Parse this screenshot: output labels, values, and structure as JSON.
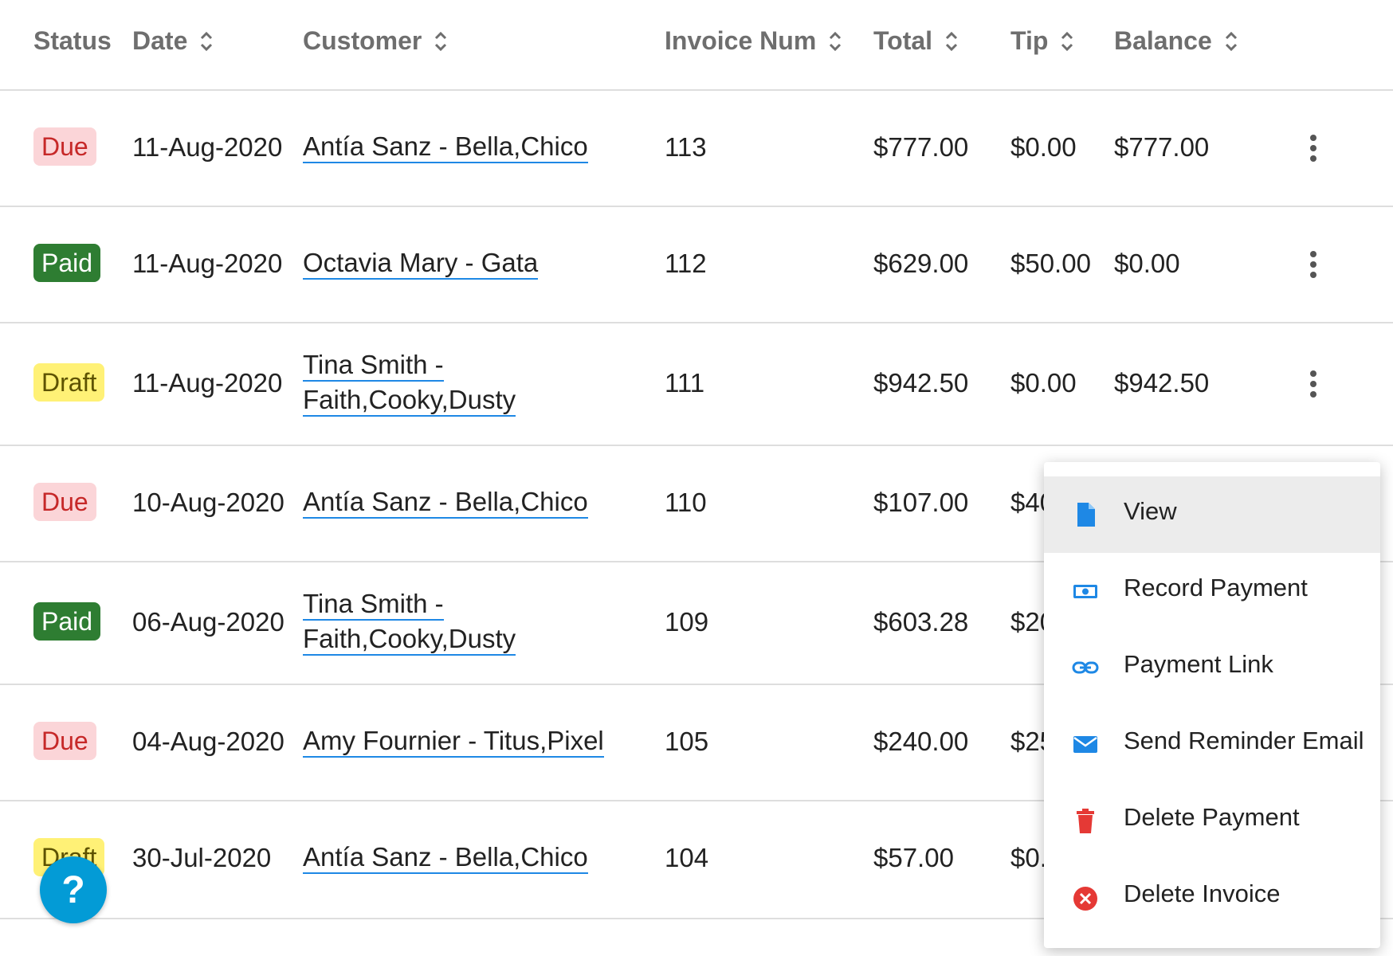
{
  "columns": {
    "status": "Status",
    "date": "Date",
    "customer": "Customer",
    "invoice_num": "Invoice Num",
    "total": "Total",
    "tip": "Tip",
    "balance": "Balance"
  },
  "rows": [
    {
      "status": "Due",
      "date": "11-Aug-2020",
      "customer_line1": "Antía Sanz - Bella,Chico",
      "customer_line2": "",
      "invoice": "113",
      "total": "$777.00",
      "tip": "$0.00",
      "balance": "$777.00"
    },
    {
      "status": "Paid",
      "date": "11-Aug-2020",
      "customer_line1": "Octavia Mary - Gata",
      "customer_line2": "",
      "invoice": "112",
      "total": "$629.00",
      "tip": "$50.00",
      "balance": "$0.00"
    },
    {
      "status": "Draft",
      "date": "11-Aug-2020",
      "customer_line1": "Tina Smith -",
      "customer_line2": "Faith,Cooky,Dusty",
      "invoice": "111",
      "total": "$942.50",
      "tip": "$0.00",
      "balance": "$942.50"
    },
    {
      "status": "Due",
      "date": "10-Aug-2020",
      "customer_line1": "Antía Sanz - Bella,Chico",
      "customer_line2": "",
      "invoice": "110",
      "total": "$107.00",
      "tip": "$40",
      "balance": ""
    },
    {
      "status": "Paid",
      "date": "06-Aug-2020",
      "customer_line1": "Tina Smith -",
      "customer_line2": "Faith,Cooky,Dusty",
      "invoice": "109",
      "total": "$603.28",
      "tip": "$20",
      "balance": ""
    },
    {
      "status": "Due",
      "date": "04-Aug-2020",
      "customer_line1": "Amy Fournier - Titus,Pixel",
      "customer_line2": "",
      "invoice": "105",
      "total": "$240.00",
      "tip": "$25",
      "balance": ""
    },
    {
      "status": "Draft",
      "date": "30-Jul-2020",
      "customer_line1": "Antía Sanz - Bella,Chico",
      "customer_line2": "",
      "invoice": "104",
      "total": "$57.00",
      "tip": "$0.",
      "balance": ""
    }
  ],
  "menu": {
    "items": [
      {
        "label": "View",
        "icon": "document-icon"
      },
      {
        "label": "Record Payment",
        "icon": "cash-icon"
      },
      {
        "label": "Payment Link",
        "icon": "link-icon"
      },
      {
        "label": "Send Reminder Email",
        "icon": "envelope-icon"
      },
      {
        "label": "Delete Payment",
        "icon": "trash-icon"
      },
      {
        "label": "Delete Invoice",
        "icon": "cancel-circle-icon"
      }
    ]
  },
  "help": {
    "label": "?"
  },
  "colors": {
    "due_bg": "#fbd5d8",
    "due_text": "#c62828",
    "paid_bg": "#2e7d32",
    "paid_text": "#ffffff",
    "draft_bg": "#fff176",
    "draft_text": "#5d5200",
    "link_underline": "#1e88e5",
    "help_button": "#039bd6"
  }
}
